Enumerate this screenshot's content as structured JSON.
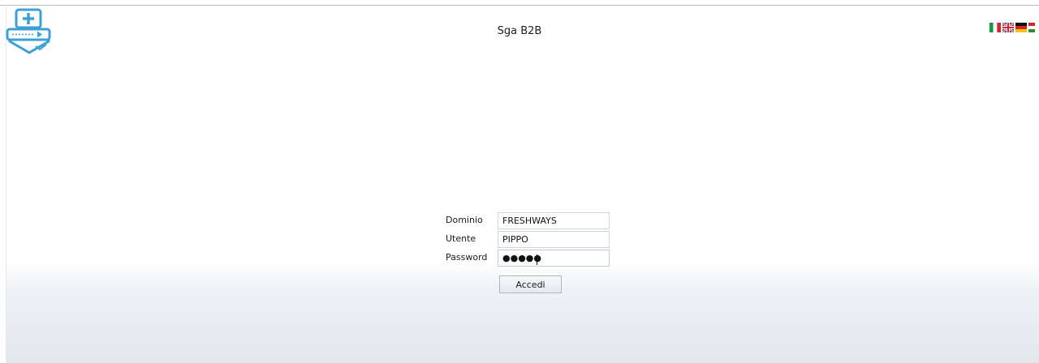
{
  "header": {
    "title": "Sga B2B",
    "logo_icon": "medical-shield-logo",
    "languages": [
      {
        "code": "it",
        "icon": "flag-italy-icon"
      },
      {
        "code": "en",
        "icon": "flag-uk-icon"
      },
      {
        "code": "de",
        "icon": "flag-germany-icon"
      },
      {
        "code": "hu",
        "icon": "flag-hungary-icon"
      }
    ]
  },
  "login": {
    "domain_label": "Dominio",
    "domain_value": "FRESHWAYS",
    "user_label": "Utente",
    "user_value": "PIPPO",
    "password_label": "Password",
    "password_value": "●●●●●",
    "submit_label": "Accedi"
  },
  "colors": {
    "logo_blue": "#3ca0d8",
    "background_gradient_end": "#e2e7ee"
  }
}
